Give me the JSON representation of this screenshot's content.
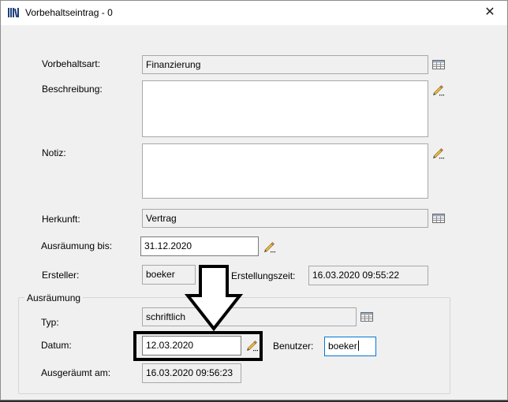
{
  "window": {
    "title": "Vorbehaltseintrag - 0",
    "close_glyph": "✕"
  },
  "fields": {
    "vorbehaltsart": {
      "label": "Vorbehaltsart:",
      "value": "Finanzierung"
    },
    "beschreibung": {
      "label": "Beschreibung:",
      "value": ""
    },
    "notiz": {
      "label": "Notiz:",
      "value": ""
    },
    "herkunft": {
      "label": "Herkunft:",
      "value": "Vertrag"
    },
    "ausraeumung_bis": {
      "label": "Ausräumung bis:",
      "value": "31.12.2020"
    },
    "ersteller": {
      "label": "Ersteller:",
      "value": "boeker"
    },
    "erstellungszeit": {
      "label": "Erstellungszeit:",
      "value": "16.03.2020 09:55:22"
    }
  },
  "ausraeumung": {
    "title": "Ausräumung",
    "typ": {
      "label": "Typ:",
      "value": "schriftlich"
    },
    "datum": {
      "label": "Datum:",
      "value": "12.03.2020"
    },
    "benutzer": {
      "label": "Benutzer:",
      "value": "boeker"
    },
    "ausgeraeumt_am": {
      "label": "Ausgeräumt am:",
      "value": "16.03.2020 09:56:23"
    }
  },
  "icons": {
    "app": "library-icon",
    "table": "table-picker-icon",
    "edit": "pencil-edit-icon",
    "annotation": "down-arrow-annotation"
  },
  "colors": {
    "focus_border": "#0078d7",
    "annotation": "#000000"
  }
}
